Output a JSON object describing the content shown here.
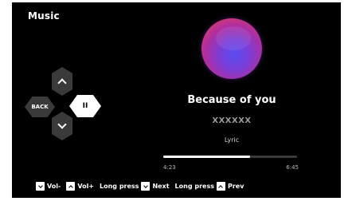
{
  "app": {
    "title": "Music"
  },
  "icons": {
    "up": "chevron-up-icon",
    "down": "chevron-down-icon",
    "pause": "pause-icon"
  },
  "dpad": {
    "back_label": "BACK",
    "pause_label": "II"
  },
  "song": {
    "title": "Because of you",
    "artist": "XXXXXX",
    "lyric": "Lyric"
  },
  "player": {
    "current_time": "4:23",
    "total_time": "6:45",
    "progress_percent": 65
  },
  "help": {
    "vol_down": "Vol-",
    "vol_up": "Vol+",
    "long_press_1": "Long press",
    "next": "Next",
    "long_press_2": "Long press",
    "prev": "Prev"
  },
  "colors": {
    "background": "#000000",
    "button": "#3a3a3a",
    "text": "#ffffff",
    "muted": "#9a9a9a"
  }
}
